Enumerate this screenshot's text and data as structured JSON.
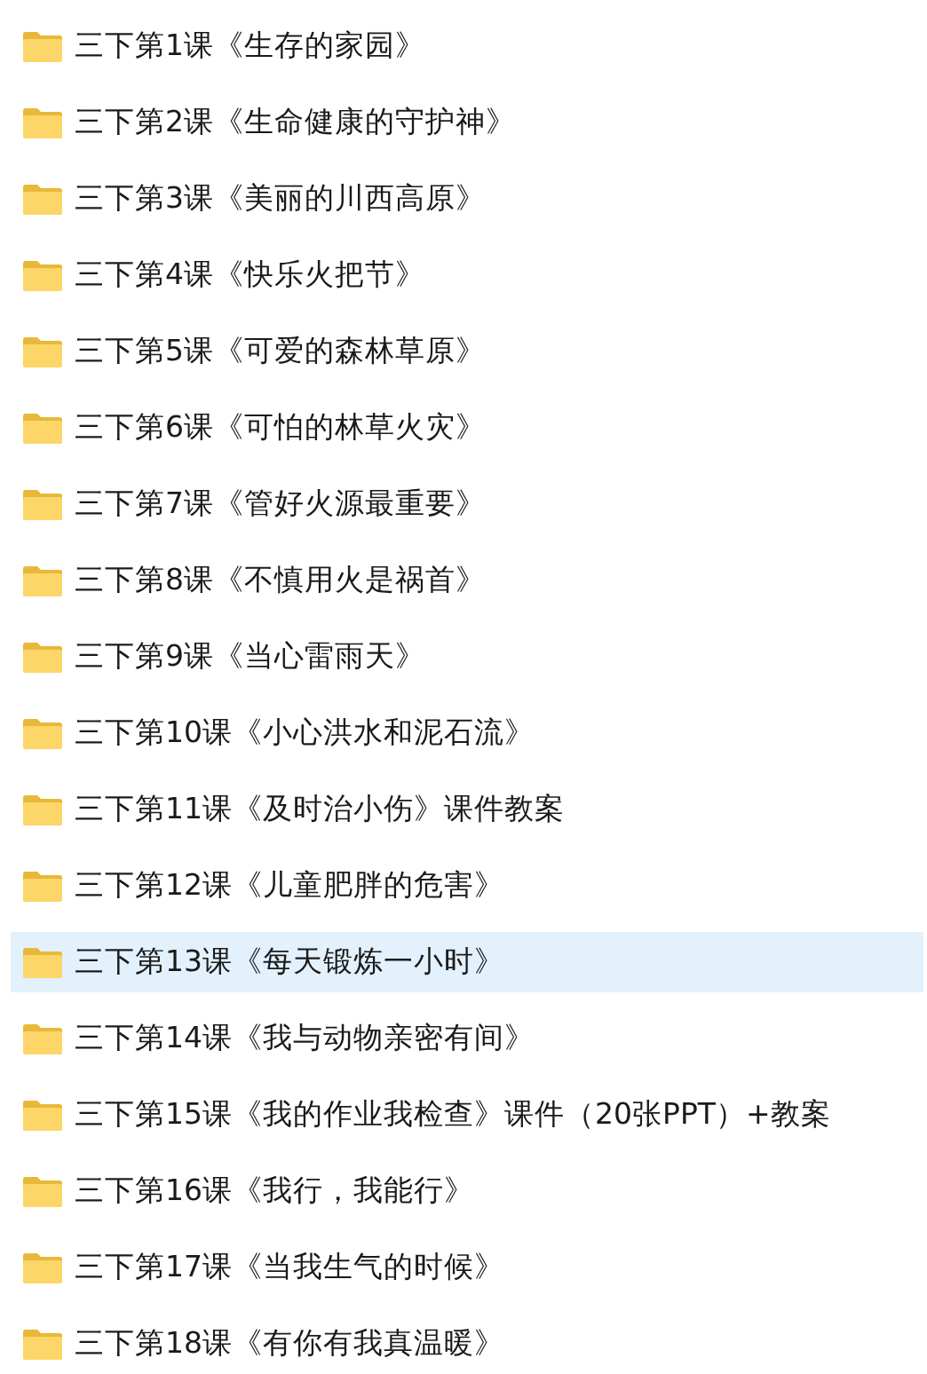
{
  "files": [
    {
      "name": "三下第1课《生存的家园》",
      "selected": false
    },
    {
      "name": "三下第2课《生命健康的守护神》",
      "selected": false
    },
    {
      "name": "三下第3课《美丽的川西高原》",
      "selected": false
    },
    {
      "name": "三下第4课《快乐火把节》",
      "selected": false
    },
    {
      "name": "三下第5课《可爱的森林草原》",
      "selected": false
    },
    {
      "name": "三下第6课《可怕的林草火灾》",
      "selected": false
    },
    {
      "name": "三下第7课《管好火源最重要》",
      "selected": false
    },
    {
      "name": "三下第8课《不慎用火是祸首》",
      "selected": false
    },
    {
      "name": "三下第9课《当心雷雨天》",
      "selected": false
    },
    {
      "name": "三下第10课《小心洪水和泥石流》",
      "selected": false
    },
    {
      "name": "三下第11课《及时治小伤》课件教案",
      "selected": false
    },
    {
      "name": "三下第12课《儿童肥胖的危害》",
      "selected": false
    },
    {
      "name": "三下第13课《每天锻炼一小时》",
      "selected": true
    },
    {
      "name": "三下第14课《我与动物亲密有间》",
      "selected": false
    },
    {
      "name": "三下第15课《我的作业我检查》课件（20张PPT）+教案",
      "selected": false
    },
    {
      "name": "三下第16课《我行，我能行》",
      "selected": false
    },
    {
      "name": "三下第17课《当我生气的时候》",
      "selected": false
    },
    {
      "name": "三下第18课《有你有我真温暖》",
      "selected": false
    }
  ]
}
